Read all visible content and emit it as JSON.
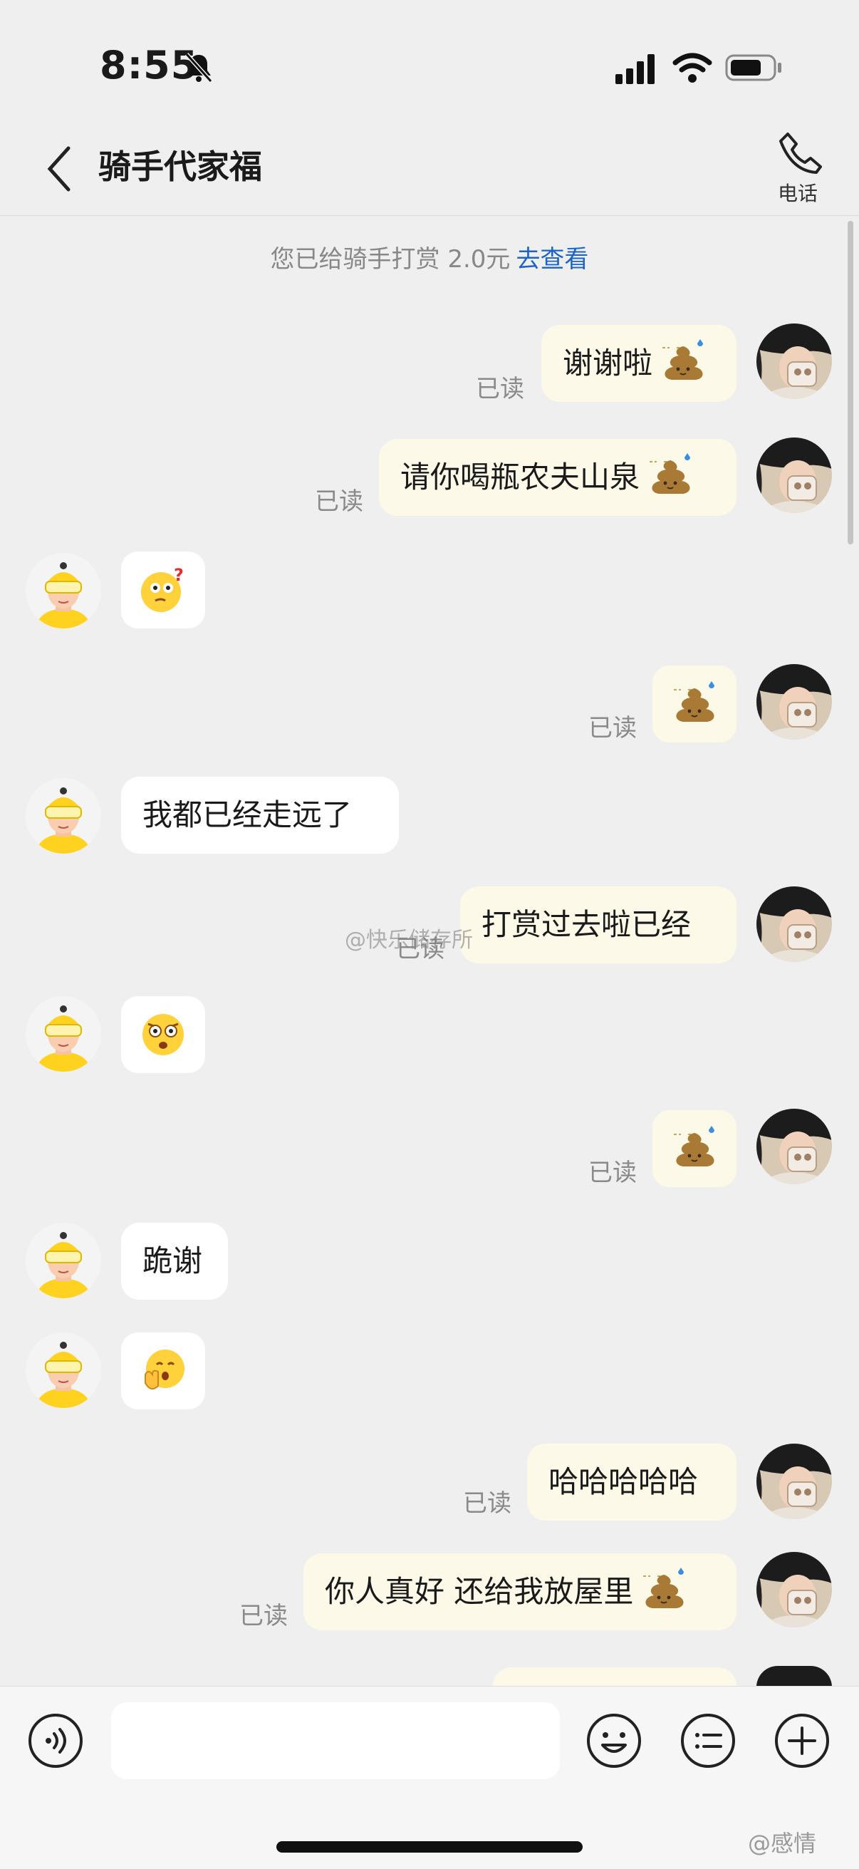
{
  "status_bar": {
    "time": "8:55"
  },
  "header": {
    "title": "骑手代家福",
    "phone_label": "电话"
  },
  "notice": {
    "text": "您已给骑手打赏 2.0元",
    "link": "去查看"
  },
  "messages": [
    {
      "side": "me",
      "text": "谢谢啦",
      "sticker": "poop-sticker",
      "status": "已读"
    },
    {
      "side": "me",
      "text": "请你喝瓶农夫山泉",
      "sticker": "poop-sticker",
      "status": "已读"
    },
    {
      "side": "rider",
      "emoji": "thinking-question-emoji"
    },
    {
      "side": "me",
      "sticker": "poop-sticker",
      "status": "已读"
    },
    {
      "side": "rider",
      "text": "我都已经走远了"
    },
    {
      "side": "me",
      "text": "打赏过去啦已经",
      "status": "已读"
    },
    {
      "side": "rider",
      "emoji": "shocked-face-emoji"
    },
    {
      "side": "me",
      "sticker": "poop-sticker",
      "status": "已读"
    },
    {
      "side": "rider",
      "text": "跪谢"
    },
    {
      "side": "rider",
      "emoji": "hand-over-mouth-emoji"
    },
    {
      "side": "me",
      "text": "哈哈哈哈哈",
      "status": "已读"
    },
    {
      "side": "me",
      "text": "你人真好 还给我放屋里",
      "sticker": "poop-sticker",
      "status": "已读"
    }
  ],
  "watermark": "@快乐储存所",
  "weibo_tag": "@感情",
  "input": {
    "placeholder": ""
  },
  "colors": {
    "background": "#efefef",
    "my_bubble": "#fdf9e8",
    "their_bubble": "#ffffff",
    "link": "#1e64c8",
    "rider_brand": "#ffd21f"
  }
}
